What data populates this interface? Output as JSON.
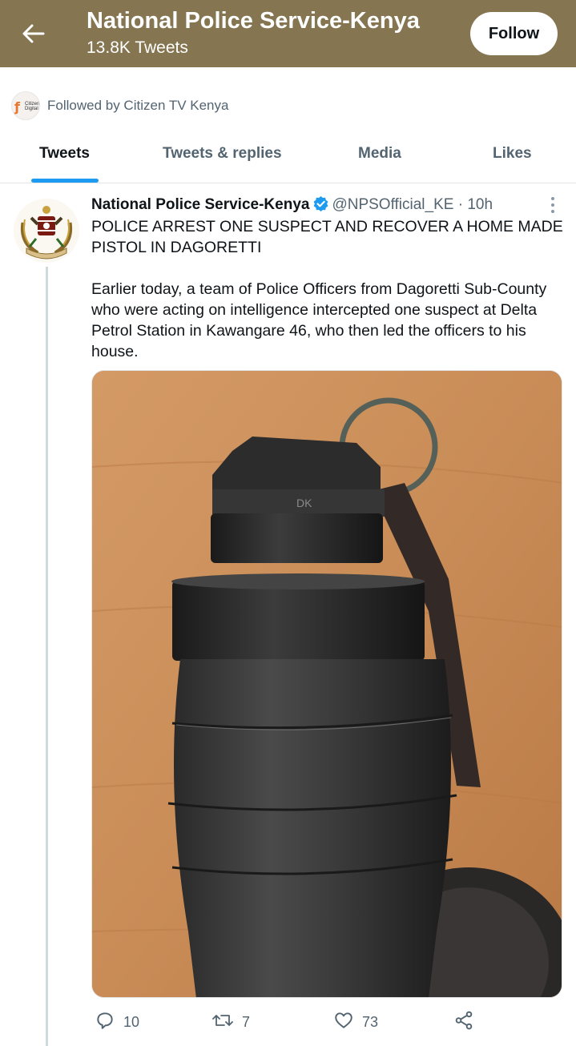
{
  "header": {
    "title": "National Police Service-Kenya",
    "subtitle": "13.8K Tweets",
    "follow_label": "Follow",
    "bg_color": "#857551"
  },
  "followed_by": {
    "text": "Followed by Citizen TV Kenya",
    "avatar_label": "Citizen Digital"
  },
  "tabs": [
    {
      "label": "Tweets",
      "active": true
    },
    {
      "label": "Tweets & replies",
      "active": false
    },
    {
      "label": "Media",
      "active": false
    },
    {
      "label": "Likes",
      "active": false
    }
  ],
  "tweet": {
    "author_name": "National Police Service-Kenya",
    "verified": true,
    "handle": "@NPSOfficial_KE",
    "separator": "·",
    "time": "10h",
    "title": "POLICE ARREST ONE SUSPECT AND RECOVER A HOME MADE PISTOL IN DAGORETTI",
    "body": "Earlier today, a team of Police Officers from Dagoretti Sub-County who were acting on intelligence intercepted one suspect at Delta Petrol Station in Kawangare 46, who then led the officers to his house.",
    "media": {
      "marking": "DK"
    },
    "actions": {
      "replies": "10",
      "retweets": "7",
      "likes": "73"
    }
  },
  "colors": {
    "accent": "#1d9bf0",
    "secondary_text": "#536471",
    "primary_text": "#0f1419"
  }
}
